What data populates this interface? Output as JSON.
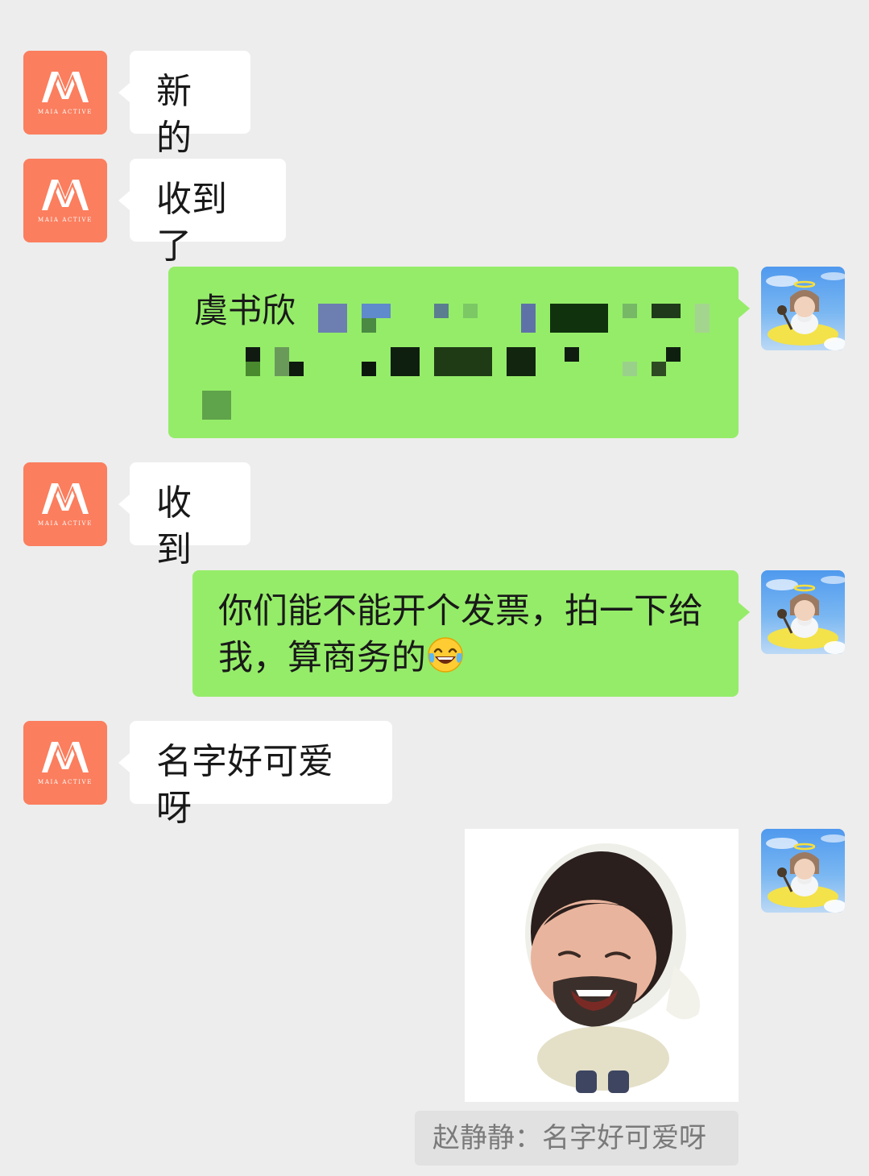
{
  "brand_avatar": {
    "logo_letter": "M",
    "logo_text": "MAIA ACTIVE",
    "color": "#fb7e5e"
  },
  "messages": [
    {
      "side": "left",
      "text": "新的"
    },
    {
      "side": "left",
      "text": "收到了"
    },
    {
      "side": "right",
      "text": "虞书欣",
      "redacted": true
    },
    {
      "side": "left",
      "text": "收到"
    },
    {
      "side": "right",
      "text": "你们能不能开个发票，拍一下给",
      "text2": "我，算商务的",
      "emoji": "tears-of-joy-emoji"
    },
    {
      "side": "left",
      "text": "名字好可爱呀"
    },
    {
      "side": "right",
      "type": "sticker",
      "sticker": "bearded-child-sticker"
    }
  ],
  "quote": {
    "text": "赵静静：名字好可爱呀"
  },
  "colors": {
    "background": "#ededed",
    "incoming_bubble": "#ffffff",
    "outgoing_bubble": "#95ec69",
    "quote_background": "#e1e1e1"
  }
}
